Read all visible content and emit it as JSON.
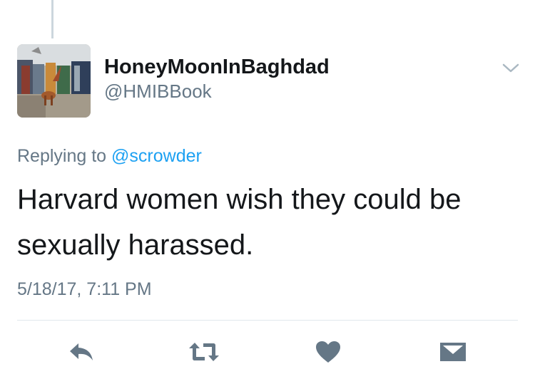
{
  "tweet": {
    "display_name": "HoneyMoonInBaghdad",
    "handle": "@HMIBBook",
    "replying_prefix": "Replying to",
    "replying_to": "@scrowder",
    "text": "Harvard women wish they could be sexually harassed.",
    "timestamp": "5/18/17, 7:11 PM"
  },
  "icons": {
    "menu": "chevron-down-icon",
    "reply": "reply-icon",
    "retweet": "retweet-icon",
    "like": "heart-icon",
    "message": "envelope-icon"
  },
  "colors": {
    "text_primary": "#14171a",
    "text_secondary": "#657786",
    "link": "#1da1f2",
    "icon": "#657786",
    "divider": "#e1e8ed"
  }
}
